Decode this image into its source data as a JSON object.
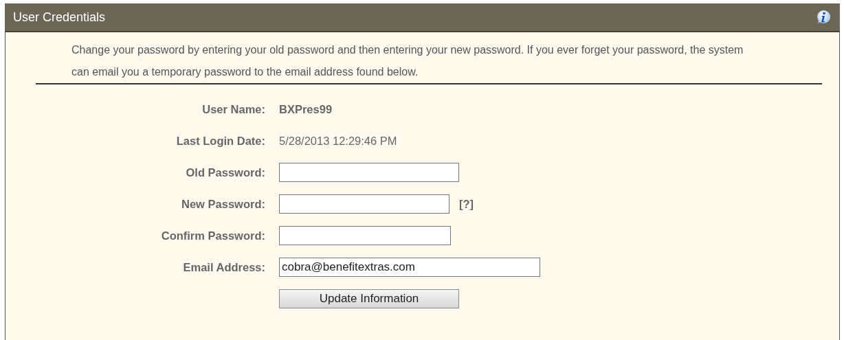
{
  "panel": {
    "title": "User Credentials",
    "intro": "Change your password by entering your old password and then entering your new password. If you ever forget your password, the system can email you a temporary password to the email address found below.",
    "fields": [
      {
        "kind": "text",
        "label": "User Name:",
        "value": "BXPres99",
        "bold": true
      },
      {
        "kind": "text",
        "label": "Last Login Date:",
        "value": "5/28/2013 12:29:46 PM",
        "bold": false
      },
      {
        "kind": "input",
        "label": "Old Password:"
      },
      {
        "kind": "input",
        "label": "New Password:",
        "help": "[?]"
      },
      {
        "kind": "input",
        "label": "Confirm Password:"
      },
      {
        "kind": "input",
        "label": "Email Address:",
        "value": "cobra@benefitextras.com"
      }
    ],
    "button": "Update Information"
  }
}
